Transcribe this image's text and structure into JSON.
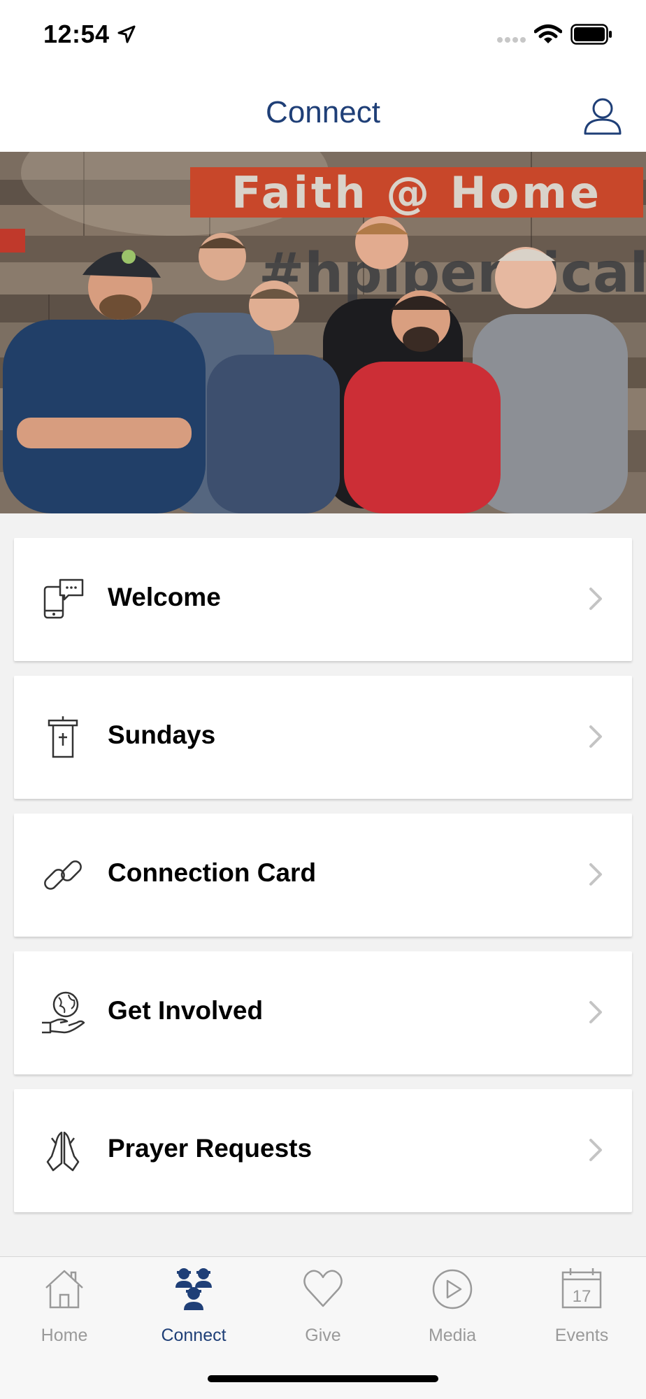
{
  "status_bar": {
    "time": "12:54"
  },
  "nav": {
    "title": "Connect",
    "profile_icon": "person-outline-icon"
  },
  "hero": {
    "sign_text": "Faith @ Home",
    "wall_text": "#hpipentical"
  },
  "menu": [
    {
      "label": "Welcome",
      "icon": "phone-chat-icon"
    },
    {
      "label": "Sundays",
      "icon": "pulpit-icon"
    },
    {
      "label": "Connection Card",
      "icon": "link-icon"
    },
    {
      "label": "Get Involved",
      "icon": "globe-hand-icon"
    },
    {
      "label": "Prayer Requests",
      "icon": "praying-hands-icon"
    }
  ],
  "tabs": [
    {
      "label": "Home",
      "icon": "house-icon",
      "active": false
    },
    {
      "label": "Connect",
      "icon": "people-icon",
      "active": true
    },
    {
      "label": "Give",
      "icon": "heart-icon",
      "active": false
    },
    {
      "label": "Media",
      "icon": "play-icon",
      "active": false
    },
    {
      "label": "Events",
      "icon": "calendar-icon",
      "active": false,
      "badge": "17"
    }
  ],
  "colors": {
    "accent": "#1f3f77",
    "inactive": "#9a9a9a",
    "background": "#f2f2f2"
  }
}
